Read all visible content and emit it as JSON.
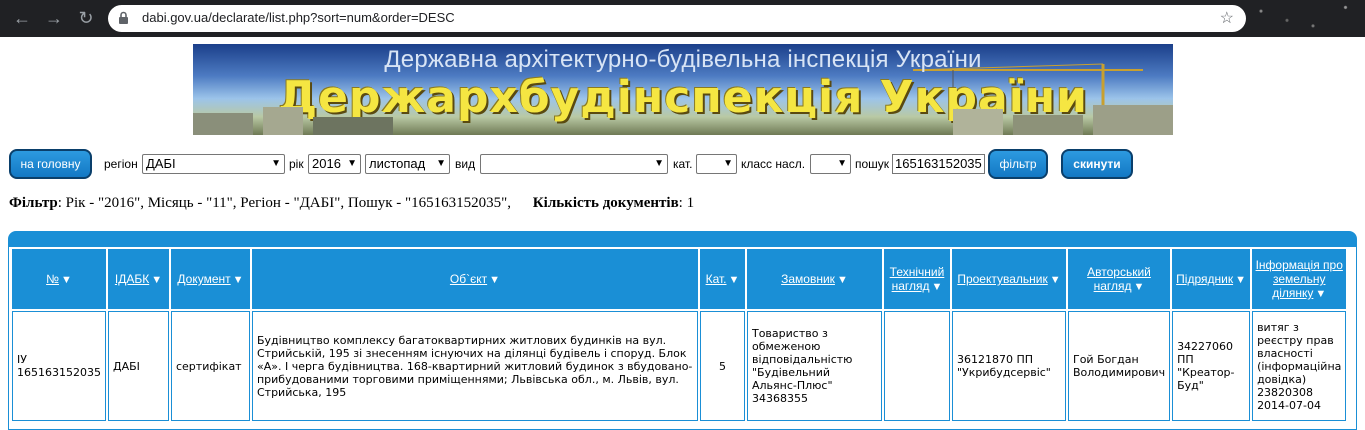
{
  "browser": {
    "url": "dabi.gov.ua/declarate/list.php?sort=num&order=DESC"
  },
  "banner": {
    "subtitle": "Державна архітектурно-будівельна інспекція України",
    "title": "Держархбудінспекція України"
  },
  "toolbar": {
    "home_button": "на головну",
    "region_label": "регіон",
    "region_value": "ДАБІ",
    "year_label": "рік",
    "year_value": "2016",
    "month_value": "листопад",
    "type_label": "вид",
    "type_value": "",
    "cat_label": "кат.",
    "cat_value": "",
    "class_label": "класс насл.",
    "class_value": "",
    "search_label": "пошук",
    "search_value": "165163152035",
    "filter_button": "фільтр",
    "reset_button": "скинути"
  },
  "summary": {
    "filter_label": "Фільтр",
    "filter_text": ": Рік - \"2016\", Місяць - \"11\", Регіон - \"ДАБІ\", Пошук - \"165163152035\",",
    "count_label": "Кількість документів",
    "count_text": ": 1"
  },
  "table": {
    "headers": [
      "№",
      "ІДАБК",
      "Документ",
      "Об`єкт",
      "Кат.",
      "Замовник",
      "Технічний нагляд",
      "Проектувальник",
      "Авторський нагляд",
      "Підрядник",
      "Інформація про земельну ділянку"
    ],
    "row": {
      "num": "ІУ 165163152035",
      "idabk": "ДАБІ",
      "document": "сертифікат",
      "object": "Будівництво комплексу багатоквартирних житлових будинків на вул. Стрийській, 195 зі знесенням існуючих на ділянці будівель і споруд. Блок «А». І черга будівництва. 168-квартирний житловий будинок з вбудовано-прибудованими торговими приміщеннями; Львівська обл., м. Львів, вул. Стрийська, 195",
      "cat": "5",
      "customer": "Товариство з обмеженою відповідальністю \"Будівельний Альянс-Плюс\" 34368355",
      "tech_supervision": "",
      "designer": "36121870 ПП \"Укрибудсервіс\"",
      "author_supervision": "Гой Богдан Володимирович",
      "contractor": "34227060 ПП \"Креатор-Буд\"",
      "land_info": "витяг з реєстру прав власності (інформаційна довідка) 23820308 2014-07-04"
    }
  },
  "colors": {
    "accent": "#1a8fd6",
    "button_border": "#0a3f6b",
    "banner_title": "#f5e642"
  }
}
